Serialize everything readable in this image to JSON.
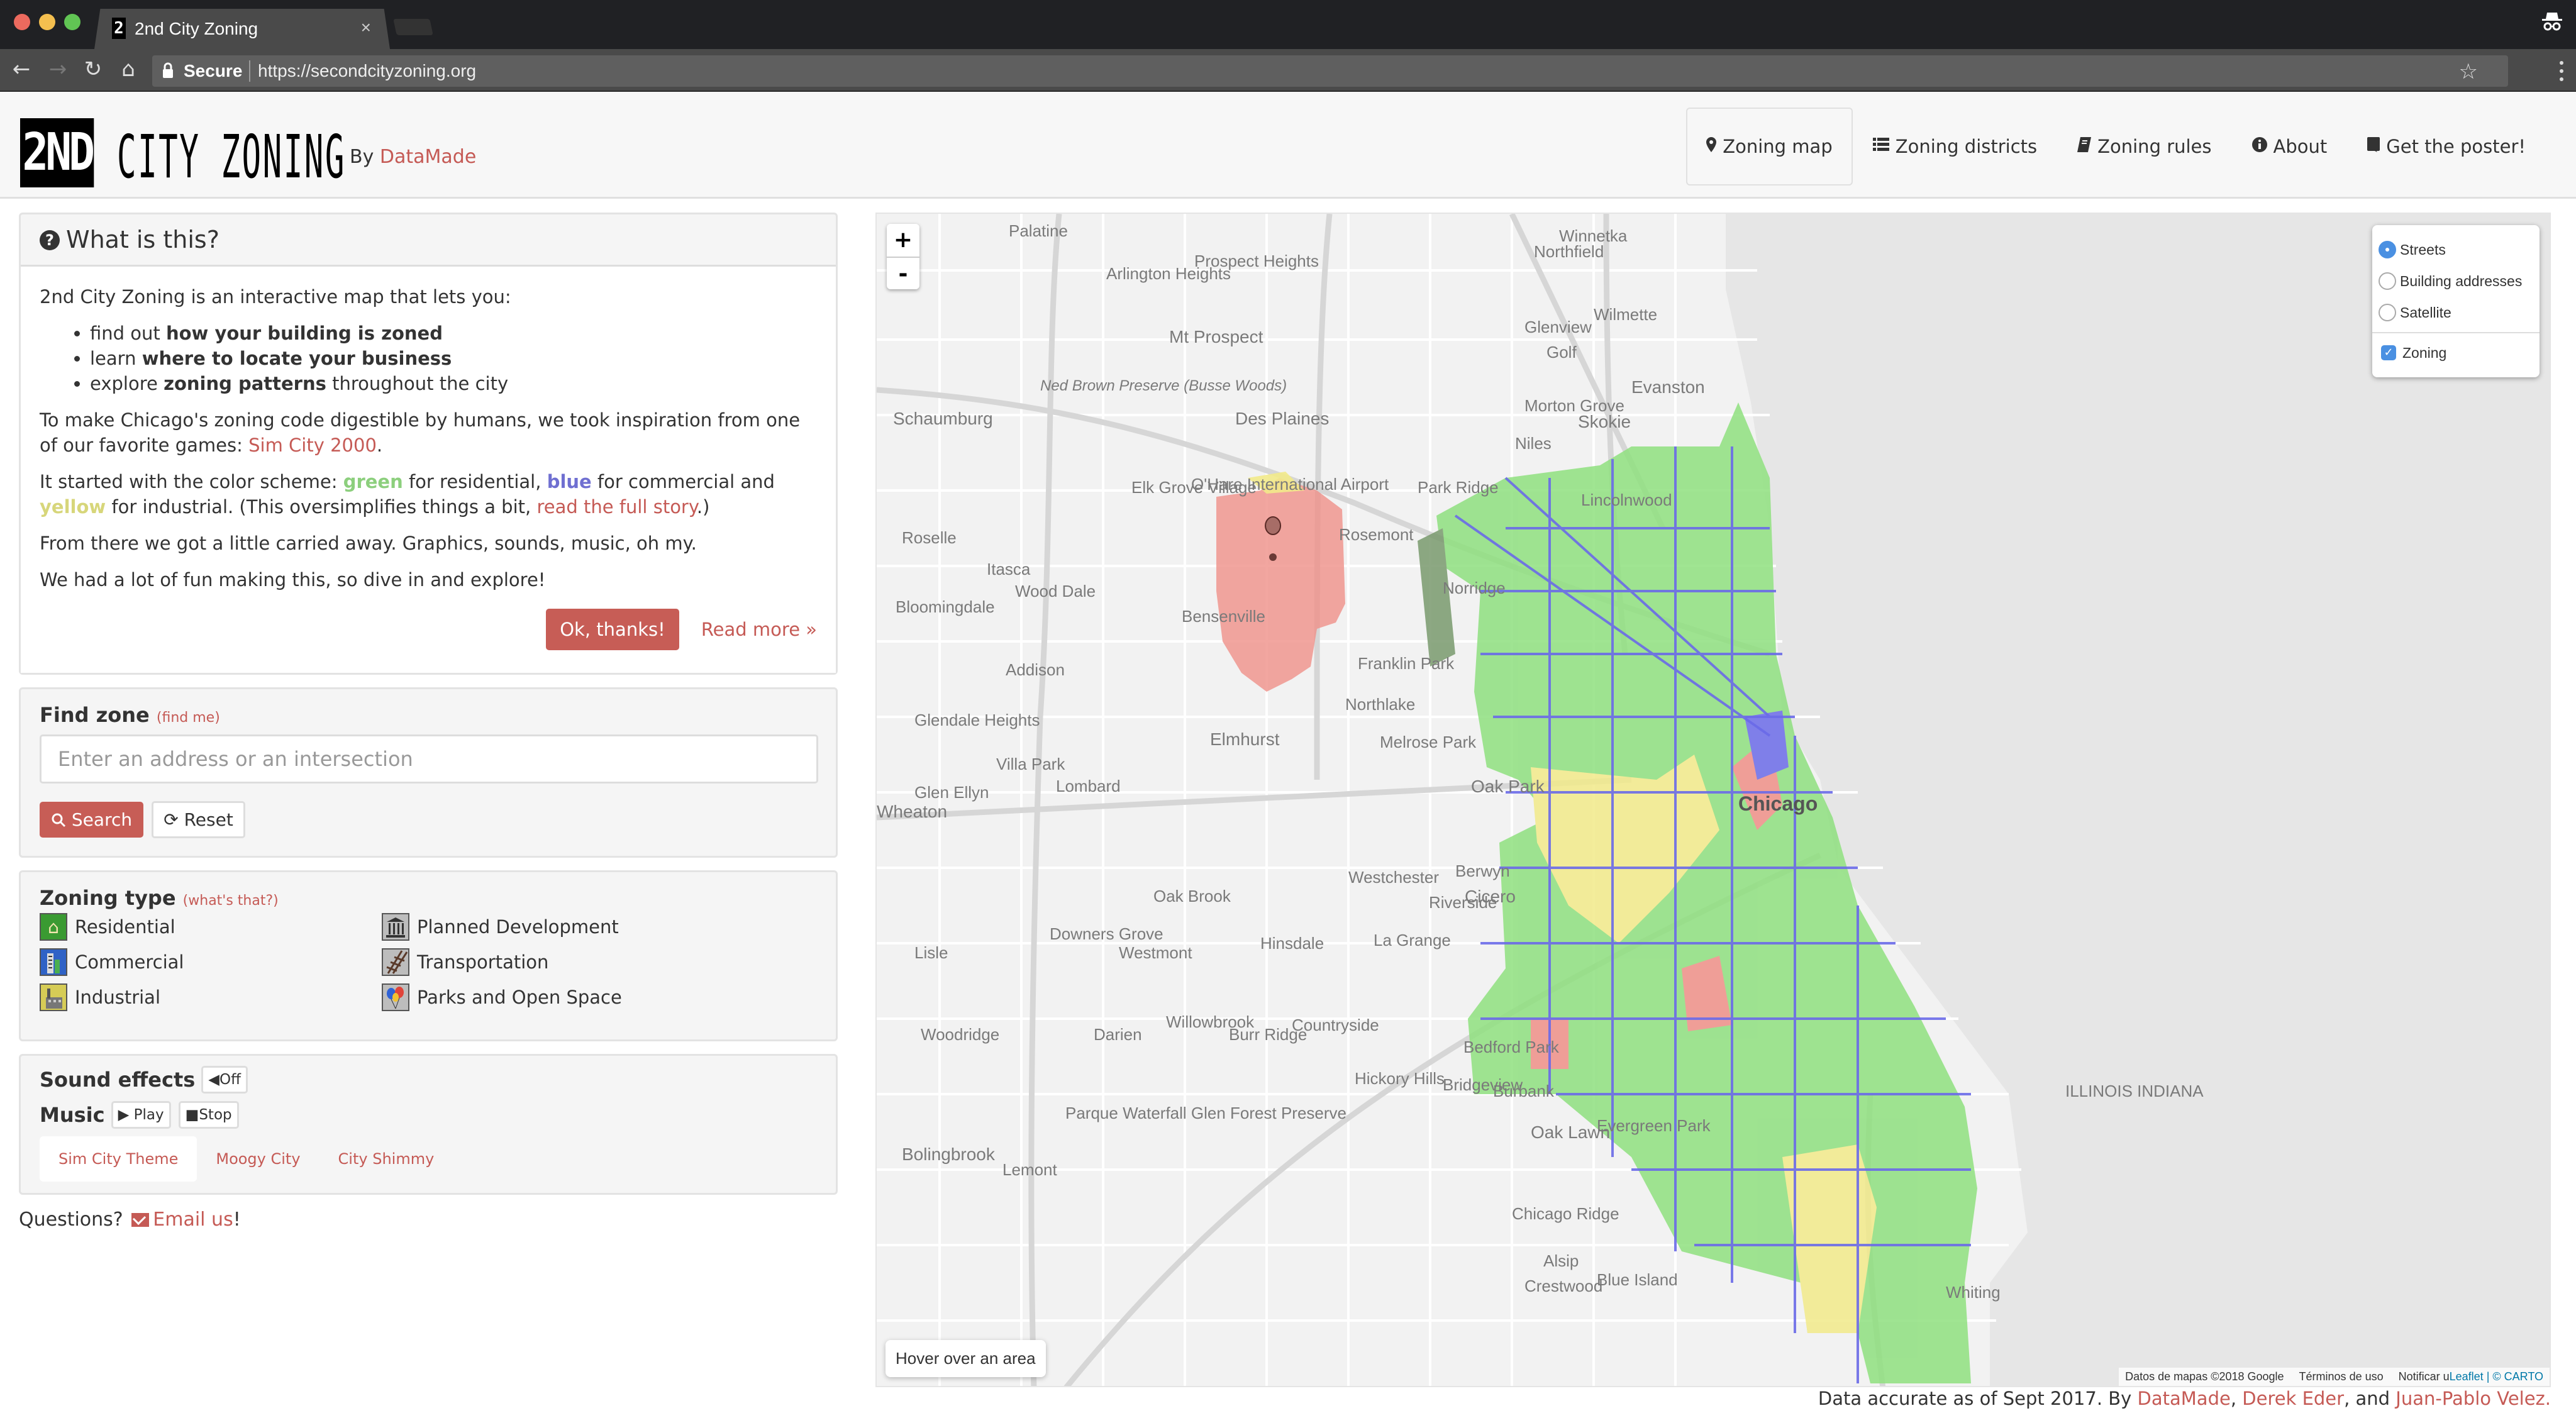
{
  "browser": {
    "tab_title": "2nd City Zoning",
    "tab_favicon": "2",
    "tab_close": "×",
    "secure_label": "Secure",
    "url": "https://secondcityzoning.org",
    "icons": [
      "back-icon",
      "forward-icon",
      "reload-icon",
      "home-icon",
      "lock-icon",
      "bookmark-star-icon",
      "menu-kebab-icon",
      "incognito-icon"
    ]
  },
  "header": {
    "logo_mark": "2ND",
    "logo_text": "CITY ZONING",
    "by_prefix": "By",
    "by_link": "DataMade",
    "nav": [
      {
        "label": "Zoning map",
        "icon": "map-marker-icon",
        "glyph": "⚲",
        "active": true
      },
      {
        "label": "Zoning districts",
        "icon": "list-icon",
        "glyph": "☰",
        "active": false
      },
      {
        "label": "Zoning rules",
        "icon": "book-icon",
        "glyph": "▮",
        "active": false
      },
      {
        "label": "About",
        "icon": "info-circle-icon",
        "glyph": "ℹ",
        "active": false
      },
      {
        "label": "Get the poster!",
        "icon": "bookmark-icon",
        "glyph": "▙",
        "active": false
      }
    ]
  },
  "intro_panel": {
    "title": "What is this?",
    "icon": "question-circle-icon",
    "lead": "2nd City Zoning is an interactive map that lets you:",
    "bullets": [
      {
        "pre": "find out ",
        "bold": "how your building is zoned",
        "post": ""
      },
      {
        "pre": "learn ",
        "bold": "where to locate your business",
        "post": ""
      },
      {
        "pre": "explore ",
        "bold": "zoning patterns",
        "post": " throughout the city"
      }
    ],
    "p2_pre": "To make Chicago's zoning code digestible by humans, we took inspiration from one of our favorite games: ",
    "p2_link": "Sim City 2000",
    "p2_post": ".",
    "p3_pre": "It started with the color scheme: ",
    "p3_green": "green",
    "p3_mid1": " for residential, ",
    "p3_blue": "blue",
    "p3_mid2": " for commercial and ",
    "p3_yellow": "yellow",
    "p3_mid3": " for industrial. (This oversimplifies things a bit, ",
    "p3_link": "read the full story",
    "p3_post": ".)",
    "p4": "From there we got a little carried away. Graphics, sounds, music, oh my.",
    "p5": "We had a lot of fun making this, so dive in and explore!",
    "ok_button": "Ok, thanks!",
    "read_more": "Read more »"
  },
  "find_zone": {
    "title": "Find zone",
    "find_me": "(find me)",
    "input_value": "",
    "placeholder": "Enter an address or an intersection",
    "search_button": "Search",
    "reset_button": "Reset"
  },
  "zoning_type": {
    "title": "Zoning type",
    "whats_that": "(what's that?)",
    "items": [
      {
        "label": "Residential",
        "icon": "residential-house-icon",
        "glyph": "⌂"
      },
      {
        "label": "Planned Development",
        "icon": "planned-development-building-icon",
        "glyph": "🏛"
      },
      {
        "label": "Commercial",
        "icon": "commercial-tower-icon",
        "glyph": "▥"
      },
      {
        "label": "Transportation",
        "icon": "railroad-track-icon",
        "glyph": "#"
      },
      {
        "label": "Industrial",
        "icon": "industrial-factory-icon",
        "glyph": "⌂"
      },
      {
        "label": "Parks and Open Space",
        "icon": "park-balloons-icon",
        "glyph": "●"
      }
    ]
  },
  "sound": {
    "effects_label": "Sound effects",
    "effects_button": "Off",
    "music_label": "Music",
    "play_button": "Play",
    "stop_button": "Stop",
    "tracks": [
      {
        "label": "Sim City Theme",
        "active": true
      },
      {
        "label": "Moogy City",
        "active": false
      },
      {
        "label": "City Shimmy",
        "active": false
      }
    ]
  },
  "questions": {
    "prefix": "Questions?",
    "link": "Email us",
    "suffix": "!"
  },
  "map": {
    "zoom_in": "+",
    "zoom_out": "-",
    "layers": {
      "base": [
        {
          "label": "Streets",
          "selected": true
        },
        {
          "label": "Building addresses",
          "selected": false
        },
        {
          "label": "Satellite",
          "selected": false
        }
      ],
      "overlays": [
        {
          "label": "Zoning",
          "checked": true
        }
      ]
    },
    "hover_info": "Hover over an area",
    "attribution": {
      "google": "Datos de mapas ©2018 Google",
      "terms": "Términos de uso",
      "report": "Notificar un problema de Maps",
      "leaflet": "Leaflet",
      "carto": "| © CARTO"
    },
    "zoning_colors": {
      "residential": "#8fe07f",
      "commercial": "#6b6be8",
      "industrial": "#f2ea8a",
      "planned_development": "#ef8a80",
      "parks": "#7a9a6e"
    },
    "labels": [
      {
        "text": "Palatine",
        "kind": "city"
      },
      {
        "text": "Arlington Heights",
        "kind": "city"
      },
      {
        "text": "Prospect Heights",
        "kind": "city"
      },
      {
        "text": "Winnetka",
        "kind": "city"
      },
      {
        "text": "Northfield",
        "kind": "city"
      },
      {
        "text": "Mt Prospect",
        "kind": "big"
      },
      {
        "text": "Glenview",
        "kind": "city"
      },
      {
        "text": "Wilmette",
        "kind": "city"
      },
      {
        "text": "Schaumburg",
        "kind": "big"
      },
      {
        "text": "Ned Brown Preserve (Busse Woods)",
        "kind": "italic"
      },
      {
        "text": "Des Plaines",
        "kind": "big"
      },
      {
        "text": "Golf",
        "kind": "city"
      },
      {
        "text": "Evanston",
        "kind": "big"
      },
      {
        "text": "Morton Grove",
        "kind": "city"
      },
      {
        "text": "Skokie",
        "kind": "big"
      },
      {
        "text": "Niles",
        "kind": "city"
      },
      {
        "text": "Elk Grove Village",
        "kind": "city"
      },
      {
        "text": "O'Hare International Airport",
        "kind": "city"
      },
      {
        "text": "Park Ridge",
        "kind": "city"
      },
      {
        "text": "Lincolnwood",
        "kind": "city"
      },
      {
        "text": "Roselle",
        "kind": "city"
      },
      {
        "text": "Rosemont",
        "kind": "city"
      },
      {
        "text": "Itasca",
        "kind": "city"
      },
      {
        "text": "Norridge",
        "kind": "city"
      },
      {
        "text": "Wood Dale",
        "kind": "city"
      },
      {
        "text": "Bloomingdale",
        "kind": "city"
      },
      {
        "text": "Bensenville",
        "kind": "city"
      },
      {
        "text": "Franklin Park",
        "kind": "city"
      },
      {
        "text": "Addison",
        "kind": "city"
      },
      {
        "text": "Northlake",
        "kind": "city"
      },
      {
        "text": "Glendale Heights",
        "kind": "city"
      },
      {
        "text": "Elmhurst",
        "kind": "big"
      },
      {
        "text": "Melrose Park",
        "kind": "city"
      },
      {
        "text": "Villa Park",
        "kind": "city"
      },
      {
        "text": "Oak Park",
        "kind": "big"
      },
      {
        "text": "Chicago",
        "kind": "chicago"
      },
      {
        "text": "Glen Ellyn",
        "kind": "city"
      },
      {
        "text": "Lombard",
        "kind": "city"
      },
      {
        "text": "Wheaton",
        "kind": "big"
      },
      {
        "text": "Westchester",
        "kind": "city"
      },
      {
        "text": "Berwyn",
        "kind": "city"
      },
      {
        "text": "Cicero",
        "kind": "big"
      },
      {
        "text": "Oak Brook",
        "kind": "city"
      },
      {
        "text": "Riverside",
        "kind": "city"
      },
      {
        "text": "Downers Grove",
        "kind": "city"
      },
      {
        "text": "La Grange",
        "kind": "city"
      },
      {
        "text": "Westmont",
        "kind": "city"
      },
      {
        "text": "Hinsdale",
        "kind": "city"
      },
      {
        "text": "Lisle",
        "kind": "city"
      },
      {
        "text": "Willowbrook",
        "kind": "city"
      },
      {
        "text": "Countryside",
        "kind": "city"
      },
      {
        "text": "Bedford Park",
        "kind": "city"
      },
      {
        "text": "Woodridge",
        "kind": "city"
      },
      {
        "text": "Darien",
        "kind": "city"
      },
      {
        "text": "Burr Ridge",
        "kind": "city"
      },
      {
        "text": "Bridgeview",
        "kind": "city"
      },
      {
        "text": "Burbank",
        "kind": "city"
      },
      {
        "text": "Hickory Hills",
        "kind": "city"
      },
      {
        "text": "Oak Lawn",
        "kind": "big"
      },
      {
        "text": "Evergreen Park",
        "kind": "city"
      },
      {
        "text": "Parque Waterfall Glen Forest Preserve",
        "kind": "city"
      },
      {
        "text": "Bolingbrook",
        "kind": "big"
      },
      {
        "text": "Chicago Ridge",
        "kind": "city"
      },
      {
        "text": "Alsip",
        "kind": "city"
      },
      {
        "text": "Crestwood",
        "kind": "city"
      },
      {
        "text": "Blue Island",
        "kind": "city"
      },
      {
        "text": "Lemont",
        "kind": "city"
      },
      {
        "text": "Whiting",
        "kind": "city"
      },
      {
        "text": "ILLINOIS INDIANA",
        "kind": "city"
      }
    ]
  },
  "footer": {
    "prefix": "Data accurate as of Sept 2017. By ",
    "link1": "DataMade",
    "sep1": ", ",
    "link2": "Derek Eder",
    "sep2": ", and ",
    "link3": "Juan-Pablo Velez."
  }
}
